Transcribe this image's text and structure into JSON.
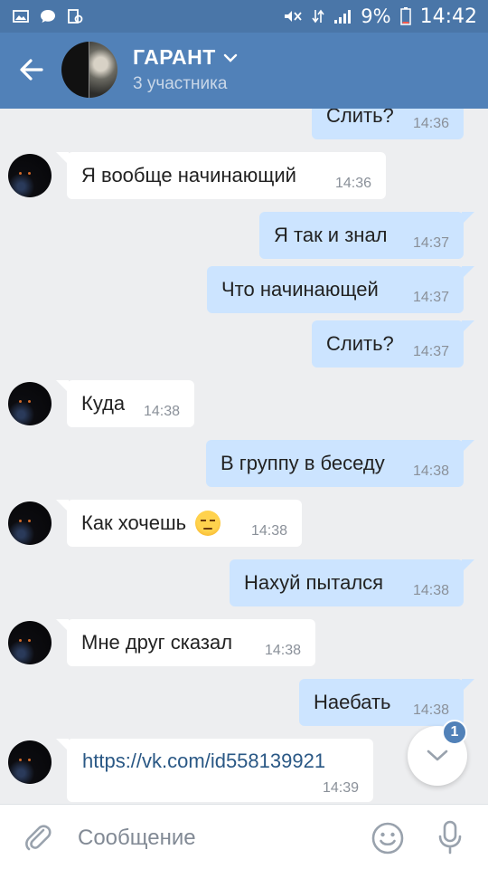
{
  "status_bar": {
    "battery": "9%",
    "time": "14:42",
    "icons": [
      "image-icon",
      "chat-icon",
      "app-icon",
      "mute-icon",
      "data-icon",
      "signal-icon",
      "battery-icon"
    ]
  },
  "header": {
    "title": "ГАРАНТ",
    "subtitle": "3 участника"
  },
  "messages": [
    {
      "dir": "out",
      "text": "Слить?",
      "time": "14:36"
    },
    {
      "dir": "in",
      "text": "Я вообще начинающий",
      "time": "14:36"
    },
    {
      "dir": "out",
      "text": "Я так и знал",
      "time": "14:37"
    },
    {
      "dir": "out",
      "text": "Что начинающей",
      "time": "14:37"
    },
    {
      "dir": "out",
      "text": "Слить?",
      "time": "14:37"
    },
    {
      "dir": "in",
      "text": "Куда",
      "time": "14:38"
    },
    {
      "dir": "out",
      "text": "В группу в беседу",
      "time": "14:38"
    },
    {
      "dir": "in",
      "text": "Как хочешь",
      "time": "14:38",
      "emoji": "unamused-face-icon"
    },
    {
      "dir": "out",
      "text": "Нахуй пытался",
      "time": "14:38"
    },
    {
      "dir": "in",
      "text": "Мне друг сказал",
      "time": "14:38"
    },
    {
      "dir": "out",
      "text": "Наебать",
      "time": "14:38"
    },
    {
      "dir": "in",
      "text": "https://vk.com/id558139921",
      "time": "14:39",
      "link": true
    }
  ],
  "scroll_down": {
    "badge": "1"
  },
  "composer": {
    "placeholder": "Сообщение"
  },
  "colors": {
    "status_bar": "#4a76a8",
    "header": "#5181b8",
    "background": "#edeef0",
    "outgoing_bubble": "#cce4ff",
    "incoming_bubble": "#ffffff",
    "link": "#2a5885"
  }
}
